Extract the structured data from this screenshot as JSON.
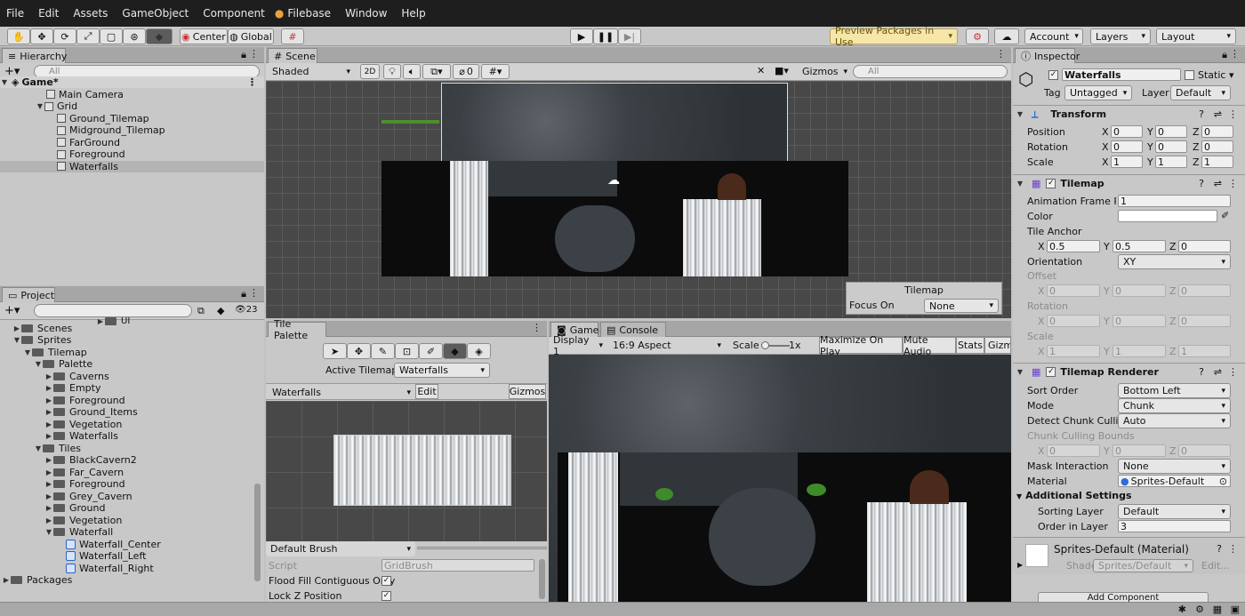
{
  "menu": [
    "File",
    "Edit",
    "Assets",
    "GameObject",
    "Component",
    "Filebase",
    "Window",
    "Help"
  ],
  "toolbar": {
    "center": "Center",
    "global": "Global",
    "preview": "Preview Packages in Use",
    "account": "Account",
    "layers": "Layers",
    "layout": "Layout"
  },
  "hierarchy": {
    "tab": "Hierarchy",
    "search": "All",
    "scene": "Game*",
    "items": [
      "Main Camera",
      "Grid",
      "Ground_Tilemap",
      "Midground_Tilemap",
      "FarGround",
      "Foreground",
      "Waterfalls"
    ]
  },
  "project": {
    "tab": "Project",
    "badge": "23",
    "partial": "UI",
    "items": [
      "Scenes",
      "Sprites",
      "Tilemap",
      "Palette",
      "Caverns",
      "Empty",
      "Foreground",
      "Ground_Items",
      "Vegetation",
      "Waterfalls",
      "Tiles",
      "BlackCavern2",
      "Far_Cavern",
      "Foreground",
      "Grey_Cavern",
      "Ground",
      "Vegetation",
      "Waterfall",
      "Waterfall_Center",
      "Waterfall_Left",
      "Waterfall_Right",
      "Packages"
    ]
  },
  "scene": {
    "tab": "Scene",
    "shading": "Shaded",
    "mode2d": "2D",
    "fx_count": "0",
    "gizmos": "Gizmos",
    "search": "All",
    "overlay": {
      "title": "Tilemap",
      "focus_label": "Focus On",
      "focus_value": "None"
    }
  },
  "palette": {
    "tab": "Tile Palette",
    "active_label": "Active Tilemap",
    "active_value": "Waterfalls",
    "palette_value": "Waterfalls",
    "edit": "Edit",
    "gizmos": "Gizmos",
    "brush": "Default Brush",
    "script_label": "Script",
    "script_value": "GridBrush",
    "flood": "Flood Fill Contiguous Only",
    "lockz": "Lock Z Position"
  },
  "game": {
    "tab": "Game",
    "console": "Console",
    "display": "Display 1",
    "aspect": "16:9 Aspect",
    "scale_label": "Scale",
    "scale_value": "1x",
    "maximize": "Maximize On Play",
    "mute": "Mute Audio",
    "stats": "Stats",
    "gizmos": "Gizm"
  },
  "inspector": {
    "tab": "Inspector",
    "name": "Waterfalls",
    "static": "Static",
    "tag_label": "Tag",
    "tag_value": "Untagged",
    "layer_label": "Layer",
    "layer_value": "Default",
    "transform": {
      "title": "Transform",
      "position": [
        "0",
        "0",
        "0"
      ],
      "rotation": [
        "0",
        "0",
        "0"
      ],
      "scale": [
        "1",
        "1",
        "1"
      ],
      "pos_label": "Position",
      "rot_label": "Rotation",
      "scale_label": "Scale"
    },
    "tilemap": {
      "title": "Tilemap",
      "anim_label": "Animation Frame Rate",
      "anim_value": "1",
      "color_label": "Color",
      "anchor_label": "Tile Anchor",
      "anchor": [
        "0.5",
        "0.5",
        "0"
      ],
      "orient_label": "Orientation",
      "orient_value": "XY",
      "offset_label": "Offset",
      "offset": [
        "0",
        "0",
        "0"
      ],
      "rotation_label": "Rotation",
      "rotation": [
        "0",
        "0",
        "0"
      ],
      "scale_label": "Scale",
      "scale": [
        "1",
        "1",
        "1"
      ]
    },
    "renderer": {
      "title": "Tilemap Renderer",
      "sort_label": "Sort Order",
      "sort_value": "Bottom Left",
      "mode_label": "Mode",
      "mode_value": "Chunk",
      "cull_label": "Detect Chunk Culling",
      "cull_value": "Auto",
      "bounds_label": "Chunk Culling Bounds",
      "bounds": [
        "0",
        "0",
        "0"
      ],
      "mask_label": "Mask Interaction",
      "mask_value": "None",
      "material_label": "Material",
      "material_value": "Sprites-Default",
      "additional": "Additional Settings",
      "sorting_label": "Sorting Layer",
      "sorting_value": "Default",
      "order_label": "Order in Layer",
      "order_value": "3"
    },
    "material": {
      "title": "Sprites-Default (Material)",
      "shader_label": "Shader",
      "shader_value": "Sprites/Default",
      "edit": "Edit..."
    },
    "add_component": "Add Component"
  },
  "axis": {
    "x": "X",
    "y": "Y",
    "z": "Z"
  }
}
